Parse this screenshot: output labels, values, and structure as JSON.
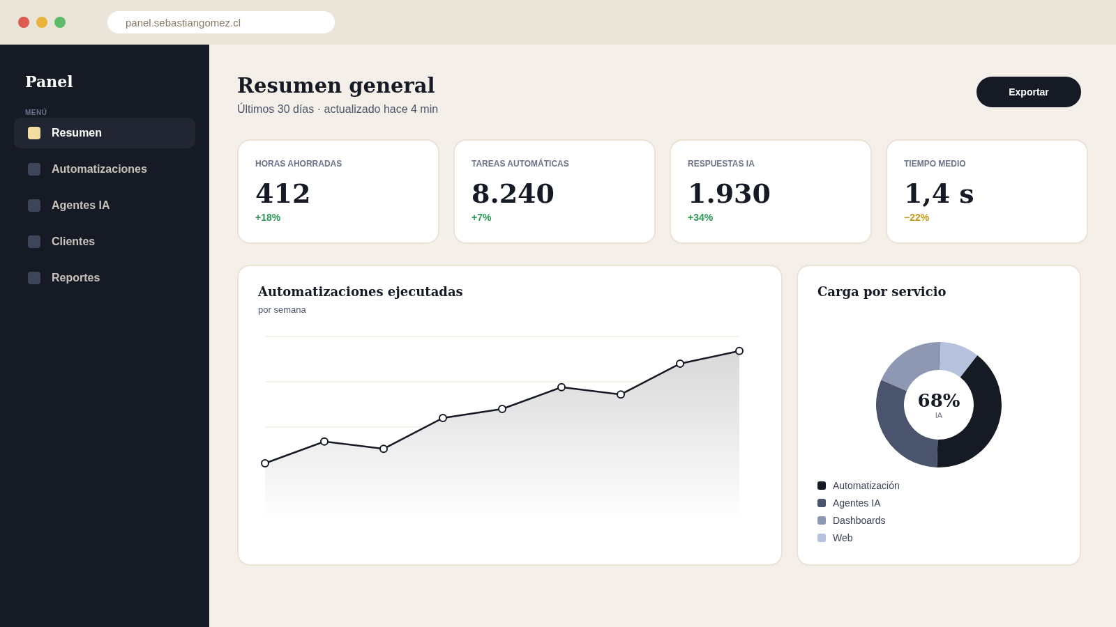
{
  "browser": {
    "url": "panel.sebastiangomez.cl"
  },
  "sidebar": {
    "title": "Panel",
    "section_label": "MENÚ",
    "items": [
      {
        "label": "Resumen",
        "selected": true
      },
      {
        "label": "Automatizaciones",
        "selected": false
      },
      {
        "label": "Agentes IA",
        "selected": false
      },
      {
        "label": "Clientes",
        "selected": false
      },
      {
        "label": "Reportes",
        "selected": false
      }
    ]
  },
  "header": {
    "title": "Resumen general",
    "subtitle": "Últimos 30 días · actualizado hace 4 min",
    "button": "Exportar"
  },
  "kpis": [
    {
      "label": "HORAS AHORRADAS",
      "value": "412",
      "delta": "+18%",
      "kind": "up"
    },
    {
      "label": "TAREAS AUTOMÁTICAS",
      "value": "8.240",
      "delta": "+7%",
      "kind": "up"
    },
    {
      "label": "RESPUESTAS IA",
      "value": "1.930",
      "delta": "+34%",
      "kind": "up"
    },
    {
      "label": "TIEMPO MEDIO",
      "value": "1,4 s",
      "delta": "−22%",
      "kind": "down"
    }
  ],
  "line_panel": {
    "title": "Automatizaciones ejecutadas",
    "subtitle": "por semana"
  },
  "donut_panel": {
    "title": "Carga por servicio",
    "center_value": "68%",
    "center_label": "IA",
    "legend": [
      {
        "label": "Automatización",
        "color": "#161a25"
      },
      {
        "label": "Agentes IA",
        "color": "#4a546c"
      },
      {
        "label": "Dashboards",
        "color": "#8e98b2"
      },
      {
        "label": "Web",
        "color": "#b6c1dd"
      }
    ]
  }
}
